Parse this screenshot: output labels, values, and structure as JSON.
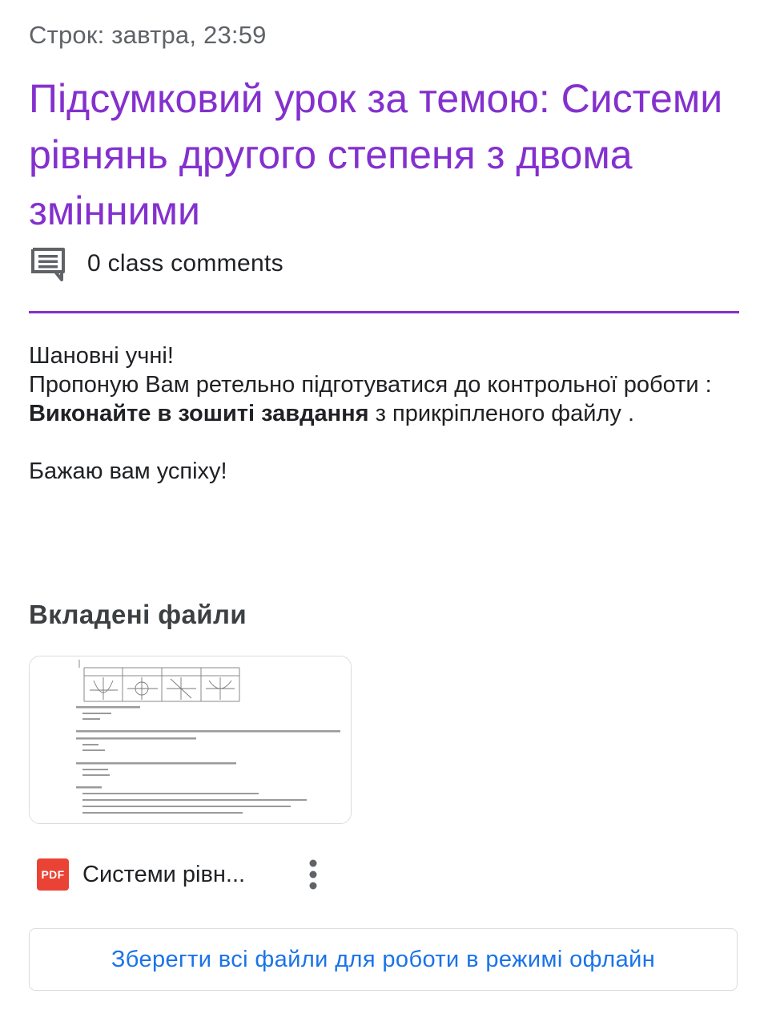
{
  "assignment": {
    "due": "Строк: завтра, 23:59",
    "title": "Підсумковий урок за темою: Системи рівнянь другого степеня з двома змінними",
    "comments_label": "0 class comments",
    "accent_color": "#8430ce"
  },
  "description": {
    "greeting": "Шановні учні!",
    "line1": "Пропоную Вам ретельно підготуватися до контрольної роботи :",
    "line2_bold": "Виконайте в зошиті завдання",
    "line2_rest": " з прикріпленого файлу .",
    "closing": "Бажаю вам успіху!"
  },
  "attachments": {
    "heading": "Вкладені файли",
    "files": [
      {
        "type_badge": "PDF",
        "name": "Системи рівн...",
        "icon": "pdf-icon"
      }
    ],
    "save_offline_label": "Зберегти всі файли для роботи в режимі офлайн"
  }
}
